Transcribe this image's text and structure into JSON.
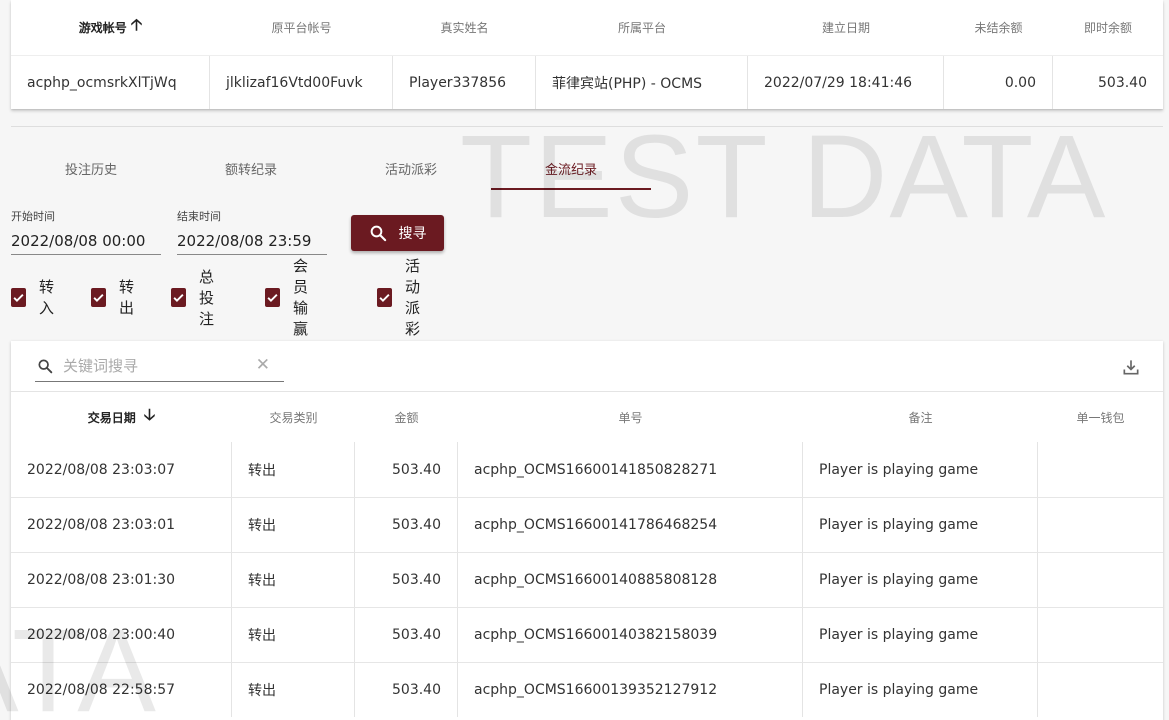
{
  "account_table": {
    "headers": [
      "游戏帐号",
      "原平台帐号",
      "真实姓名",
      "所属平台",
      "建立日期",
      "未结余额",
      "即时余额"
    ],
    "row": [
      "acphp_ocmsrkXlTjWq",
      "jlklizaf16Vtd00Fuvk",
      "Player337856",
      "菲律宾站(PHP) - OCMS",
      "2022/07/29 18:41:46",
      "0.00",
      "503.40"
    ]
  },
  "watermark": "TEST DATA",
  "watermark_partial": "ATA",
  "tabs": [
    {
      "label": "投注历史",
      "active": false
    },
    {
      "label": "额转纪录",
      "active": false
    },
    {
      "label": "活动派彩",
      "active": false
    },
    {
      "label": "金流纪录",
      "active": true
    }
  ],
  "filters": {
    "start_label": "开始时间",
    "start_value": "2022/08/08 00:00",
    "end_label": "结束时间",
    "end_value": "2022/08/08 23:59",
    "search_label": "搜寻"
  },
  "checkboxes": [
    {
      "label": "转入",
      "checked": true
    },
    {
      "label": "转出",
      "checked": true
    },
    {
      "label": "总投注",
      "checked": true
    },
    {
      "label": "会员输赢",
      "checked": true
    },
    {
      "label": "活动派彩",
      "checked": true
    }
  ],
  "search": {
    "placeholder": "关键词搜寻",
    "value": ""
  },
  "records": {
    "headers": [
      "交易日期",
      "交易类别",
      "金额",
      "单号",
      "备注",
      "单一钱包"
    ],
    "rows": [
      [
        "2022/08/08 23:03:07",
        "转出",
        "503.40",
        "acphp_OCMS16600141850828271",
        "Player is playing game",
        ""
      ],
      [
        "2022/08/08 23:03:01",
        "转出",
        "503.40",
        "acphp_OCMS16600141786468254",
        "Player is playing game",
        ""
      ],
      [
        "2022/08/08 23:01:30",
        "转出",
        "503.40",
        "acphp_OCMS16600140885808128",
        "Player is playing game",
        ""
      ],
      [
        "2022/08/08 23:00:40",
        "转出",
        "503.40",
        "acphp_OCMS16600140382158039",
        "Player is playing game",
        ""
      ],
      [
        "2022/08/08 22:58:57",
        "转出",
        "503.40",
        "acphp_OCMS16600139352127912",
        "Player is playing game",
        ""
      ]
    ]
  },
  "colors": {
    "accent": "#6b1a21",
    "page_background": "#f6f6f6",
    "card_background": "#ffffff"
  },
  "icons": {
    "account_sort": "arrow-up-icon",
    "records_sort": "arrow-down-icon",
    "search": "search-icon",
    "clear": "close-icon",
    "download": "download-icon",
    "checkbox": "check-icon"
  }
}
